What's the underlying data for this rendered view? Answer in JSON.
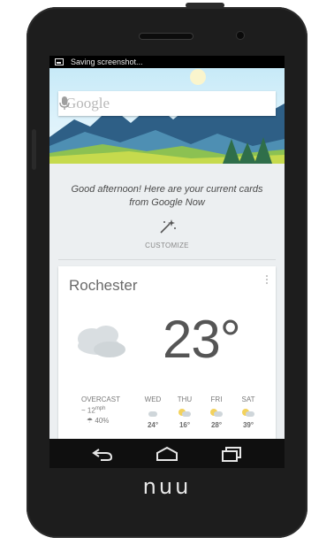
{
  "status_bar": {
    "notification": "Saving screenshot..."
  },
  "search": {
    "logo_text": "Google"
  },
  "intro": {
    "message": "Good afternoon! Here are your current cards from Google Now",
    "customize_label": "CUSTOMIZE"
  },
  "weather": {
    "location": "Rochester",
    "temperature": "23°",
    "condition": "OVERCAST",
    "wind": "12",
    "wind_unit": "mph",
    "precip": "40%",
    "forecast": [
      {
        "day": "WED",
        "high": "24°",
        "icon": "cloudy-icon"
      },
      {
        "day": "THU",
        "high": "16°",
        "icon": "partly-sunny-icon"
      },
      {
        "day": "FRI",
        "high": "28°",
        "icon": "partly-sunny-icon"
      },
      {
        "day": "SAT",
        "high": "39°",
        "icon": "partly-sunny-icon"
      }
    ]
  },
  "device": {
    "brand": "nuu"
  }
}
